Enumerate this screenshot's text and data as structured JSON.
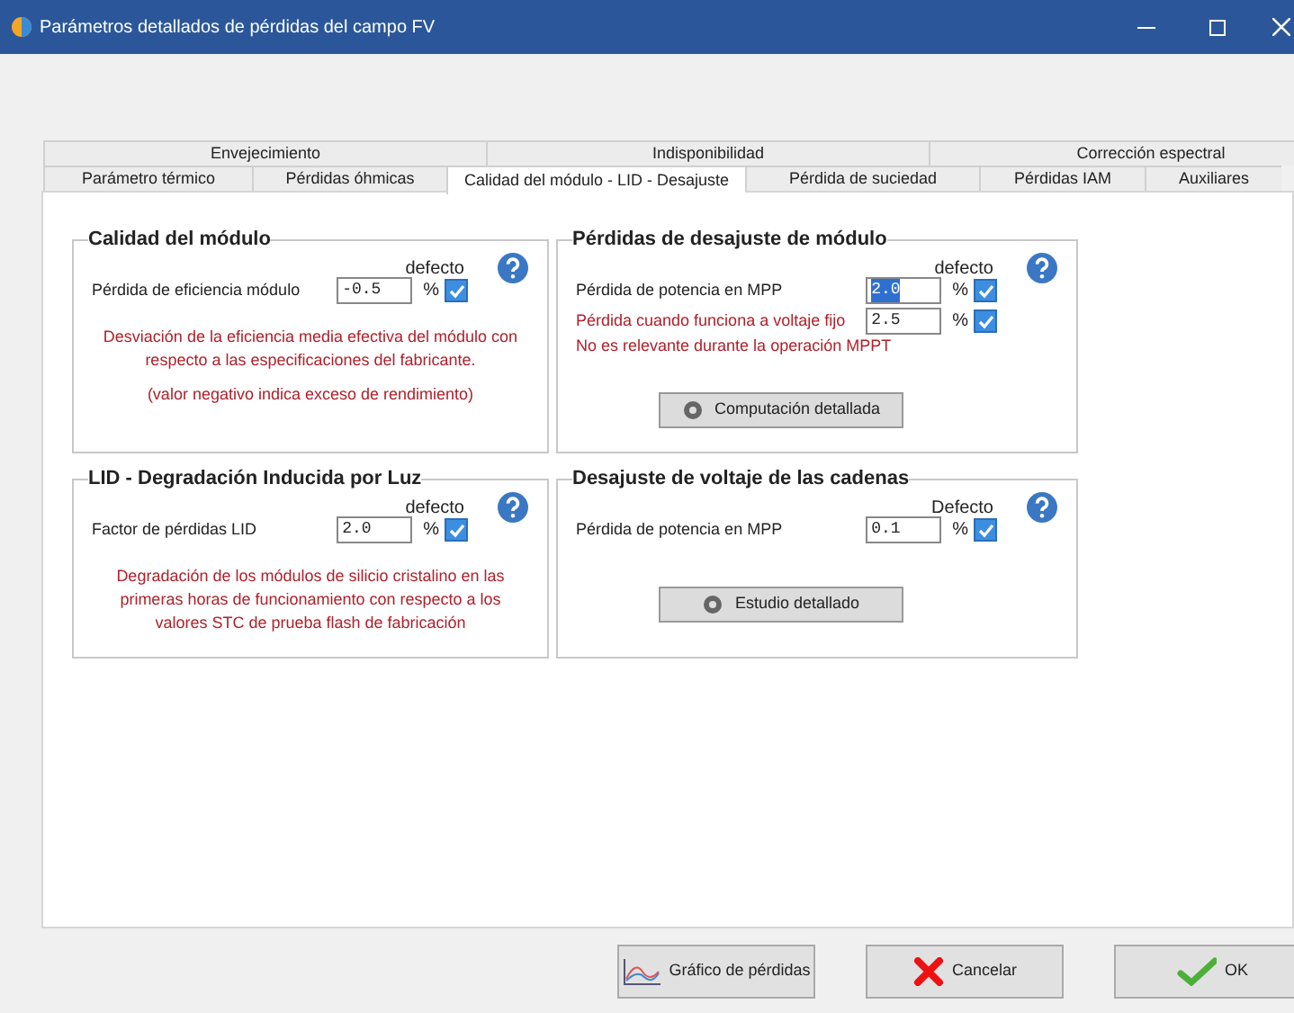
{
  "window": {
    "title": "Parámetros detallados de pérdidas del campo FV"
  },
  "tabs": {
    "back_row": [
      {
        "label": "Envejecimiento",
        "selected": false
      },
      {
        "label": "Indisponibilidad",
        "selected": false
      },
      {
        "label": "Corrección espectral",
        "selected": false
      }
    ],
    "front_row": [
      {
        "label": "Parámetro térmico",
        "selected": false
      },
      {
        "label": "Pérdidas óhmicas",
        "selected": false
      },
      {
        "label": "Calidad del módulo - LID - Desajuste",
        "selected": true
      },
      {
        "label": "Pérdida de suciedad",
        "selected": false
      },
      {
        "label": "Pérdidas IAM",
        "selected": false
      },
      {
        "label": "Auxiliares",
        "selected": false
      }
    ]
  },
  "groups": [
    {
      "title": "Calidad del módulo",
      "default_label": "defecto",
      "fields": [
        {
          "label": "Pérdida de eficiencia módulo",
          "kind": "normal",
          "value": "-0.5",
          "text_selected": false,
          "unit": "%",
          "checked": true
        }
      ],
      "notes": [
        "Desviación de la eficiencia media efectiva del módulo con respecto a las especificaciones del fabricante.",
        "(valor negativo indica exceso de rendimiento)"
      ]
    },
    {
      "title": "Pérdidas de desajuste de módulo",
      "default_label": "defecto",
      "fields": [
        {
          "label": "Pérdida de potencia en MPP",
          "kind": "normal",
          "value": "2.0",
          "text_selected": true,
          "unit": "%",
          "checked": true
        },
        {
          "label": "Pérdida cuando funciona a voltaje fijo",
          "kind": "warning",
          "value": "2.5",
          "text_selected": false,
          "unit": "%",
          "checked": true
        }
      ],
      "side_note": "No es relevante durante la operación MPPT",
      "button": "Computación detallada"
    },
    {
      "title": "LID - Degradación Inducida por Luz",
      "default_label": "defecto",
      "fields": [
        {
          "label": "Factor de pérdidas LID",
          "kind": "normal",
          "value": "2.0",
          "text_selected": false,
          "unit": "%",
          "checked": true
        }
      ],
      "notes": [
        "Degradación de los módulos de silicio cristalino en las primeras horas de funcionamiento con respecto a los valores STC de prueba flash de fabricación"
      ]
    },
    {
      "title": "Desajuste de voltaje de las cadenas",
      "default_label": "Defecto",
      "fields": [
        {
          "label": "Pérdida de potencia en MPP",
          "kind": "normal",
          "value": "0.1",
          "text_selected": false,
          "unit": "%",
          "checked": true
        }
      ],
      "button": "Estudio detallado"
    }
  ],
  "footer": {
    "buttons": [
      {
        "label": "Gráfico de pérdidas",
        "kind": "chart"
      },
      {
        "label": "Cancelar",
        "kind": "cancel"
      },
      {
        "label": "OK",
        "kind": "ok"
      }
    ]
  }
}
